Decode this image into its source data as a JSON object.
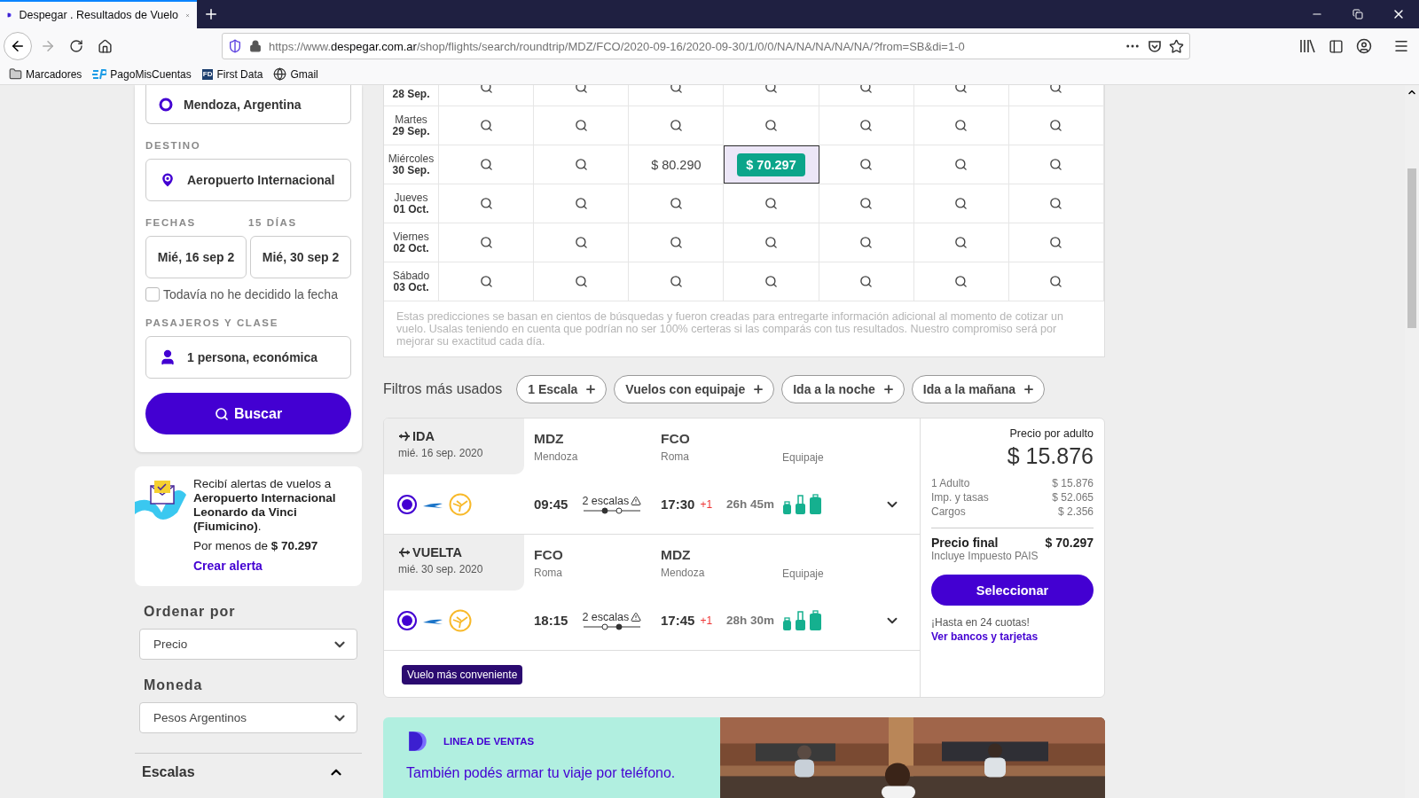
{
  "browser": {
    "tab_title": "Despegar . Resultados de Vuelo",
    "url_prefix": "https://www.",
    "url_domain": "despegar.com.ar",
    "url_path": "/shop/flights/search/roundtrip/MDZ/FCO/2020-09-16/2020-09-30/1/0/0/NA/NA/NA/NA/NA/?from=SB&di=1-0",
    "bookmarks": [
      {
        "kind": "folder",
        "label": "Marcadores"
      },
      {
        "kind": "ep",
        "label": "PagoMisCuentas"
      },
      {
        "kind": "fd",
        "badge": "FD",
        "label": "First Data"
      },
      {
        "kind": "globe",
        "label": "Gmail"
      }
    ]
  },
  "search": {
    "origin": "Mendoza, Argentina",
    "destination_label": "DESTINO",
    "destination": "Aeropuerto Internacional",
    "dates_label": "FECHAS",
    "days_label": "15 DÍAS",
    "departure_date": "Mié, 16 sep 2",
    "return_date": "Mié, 30 sep 2",
    "undecided": {
      "label": "Todavía no he decidido la fecha",
      "checked": false
    },
    "passengers_label": "PASAJEROS Y CLASE",
    "passengers": "1 persona, económica",
    "button": "Buscar"
  },
  "alert": {
    "text": "Recibí alertas de vuelos a **Aeropuerto Internacional Leonardo da Vinci (Fiumicino)**.",
    "price_text": "Por menos de **$ 70.297**",
    "link": "Crear alerta"
  },
  "sort": {
    "title": "Ordenar por",
    "value": "Precio"
  },
  "currency": {
    "title": "Moneda",
    "value": "Pesos Argentinos"
  },
  "stops_filter": {
    "title": "Escalas",
    "expanded": true
  },
  "calendar": {
    "rows": [
      {
        "date": "28 Sep.",
        "cells": [
          {
            "kind": "search",
            "selected": false
          },
          {
            "kind": "search",
            "selected": false
          },
          {
            "kind": "search",
            "selected": false
          },
          {
            "kind": "search",
            "selected": false
          },
          {
            "kind": "search",
            "selected": false
          },
          {
            "kind": "search",
            "selected": false
          },
          {
            "kind": "search",
            "selected": false
          }
        ]
      },
      {
        "day": "Martes",
        "date": "29 Sep.",
        "cells": [
          {
            "kind": "search",
            "selected": false
          },
          {
            "kind": "search",
            "selected": false
          },
          {
            "kind": "search",
            "selected": false
          },
          {
            "kind": "search",
            "selected": false
          },
          {
            "kind": "search",
            "selected": false
          },
          {
            "kind": "search",
            "selected": false
          },
          {
            "kind": "search",
            "selected": false
          }
        ]
      },
      {
        "day": "Miércoles",
        "date": "30 Sep.",
        "cells": [
          {
            "kind": "search",
            "selected": false
          },
          {
            "kind": "search",
            "selected": false
          },
          {
            "kind": "price",
            "price": "$ 80.290",
            "selected": false
          },
          {
            "kind": "best",
            "price": "$ 70.297",
            "selected": true
          },
          {
            "kind": "search",
            "selected": false
          },
          {
            "kind": "search",
            "selected": false
          },
          {
            "kind": "search",
            "selected": false
          }
        ]
      },
      {
        "day": "Jueves",
        "date": "01 Oct.",
        "cells": [
          {
            "kind": "search",
            "selected": false
          },
          {
            "kind": "search",
            "selected": false
          },
          {
            "kind": "search",
            "selected": false
          },
          {
            "kind": "search",
            "selected": false
          },
          {
            "kind": "search",
            "selected": false
          },
          {
            "kind": "search",
            "selected": false
          },
          {
            "kind": "search",
            "selected": false
          }
        ]
      },
      {
        "day": "Viernes",
        "date": "02 Oct.",
        "cells": [
          {
            "kind": "search",
            "selected": false
          },
          {
            "kind": "search",
            "selected": false
          },
          {
            "kind": "search",
            "selected": false
          },
          {
            "kind": "search",
            "selected": false
          },
          {
            "kind": "search",
            "selected": false
          },
          {
            "kind": "search",
            "selected": false
          },
          {
            "kind": "search",
            "selected": false
          }
        ]
      },
      {
        "day": "Sábado",
        "date": "03 Oct.",
        "cells": [
          {
            "kind": "search",
            "selected": false
          },
          {
            "kind": "search",
            "selected": false
          },
          {
            "kind": "search",
            "selected": false
          },
          {
            "kind": "search",
            "selected": false
          },
          {
            "kind": "search",
            "selected": false
          },
          {
            "kind": "search",
            "selected": false
          },
          {
            "kind": "search",
            "selected": false
          }
        ]
      }
    ],
    "disclaimer": "Estas predicciones se basan en cientos de búsquedas y fueron creadas para entregarte información adicional al momento de cotizar un vuelo. Usalas teniendo en cuenta que podrían no ser 100% certeras si las comparás con tus resultados. Nuestro compromiso será por mejorar su exactitud cada día."
  },
  "filters": {
    "title": "Filtros más usados",
    "chips": [
      "1 Escala",
      "Vuelos con equipaje",
      "Ida a la noche",
      "Ida a la mañana"
    ]
  },
  "result": {
    "legs": [
      {
        "kind": "outbound",
        "direction": "IDA",
        "date": "mié. 16 sep. 2020",
        "origin_code": "MDZ",
        "origin_city": "Mendoza",
        "destination_code": "FCO",
        "destination_city": "Roma",
        "baggage_label": "Equipaje",
        "selected": true,
        "departure": "09:45",
        "stops": "2 escalas",
        "stop_dots": [
          {
            "filled": true
          },
          {
            "filled": false
          }
        ],
        "arrival": "17:30",
        "day_offset": "+1",
        "duration": "26h 45m"
      },
      {
        "kind": "return",
        "direction": "VUELTA",
        "date": "mié. 30 sep. 2020",
        "origin_code": "FCO",
        "origin_city": "Roma",
        "destination_code": "MDZ",
        "destination_city": "Mendoza",
        "baggage_label": "Equipaje",
        "selected": true,
        "departure": "18:15",
        "stops": "2 escalas",
        "stop_dots": [
          {
            "filled": false
          },
          {
            "filled": true
          }
        ],
        "arrival": "17:45",
        "day_offset": "+1",
        "duration": "28h 30m"
      }
    ],
    "badge": "Vuelo más conveniente",
    "price": {
      "label": "Precio por adulto",
      "amount": "$ 15.876",
      "breakdown": [
        {
          "label": "1 Adulto",
          "value": "$ 15.876"
        },
        {
          "label": "Imp. y tasas",
          "value": "$ 52.065"
        },
        {
          "label": "Cargos",
          "value": "$ 2.356"
        }
      ],
      "final_label": "Precio final",
      "final_value": "$ 70.297",
      "final_note": "Incluye Impuesto PAIS",
      "button": "Seleccionar",
      "installments": "¡Hasta en 24 cuotas!",
      "link": "Ver bancos y tarjetas"
    }
  },
  "banner": {
    "title": "LINEA DE VENTAS",
    "text": "También podés armar tu viaje por teléfono."
  }
}
